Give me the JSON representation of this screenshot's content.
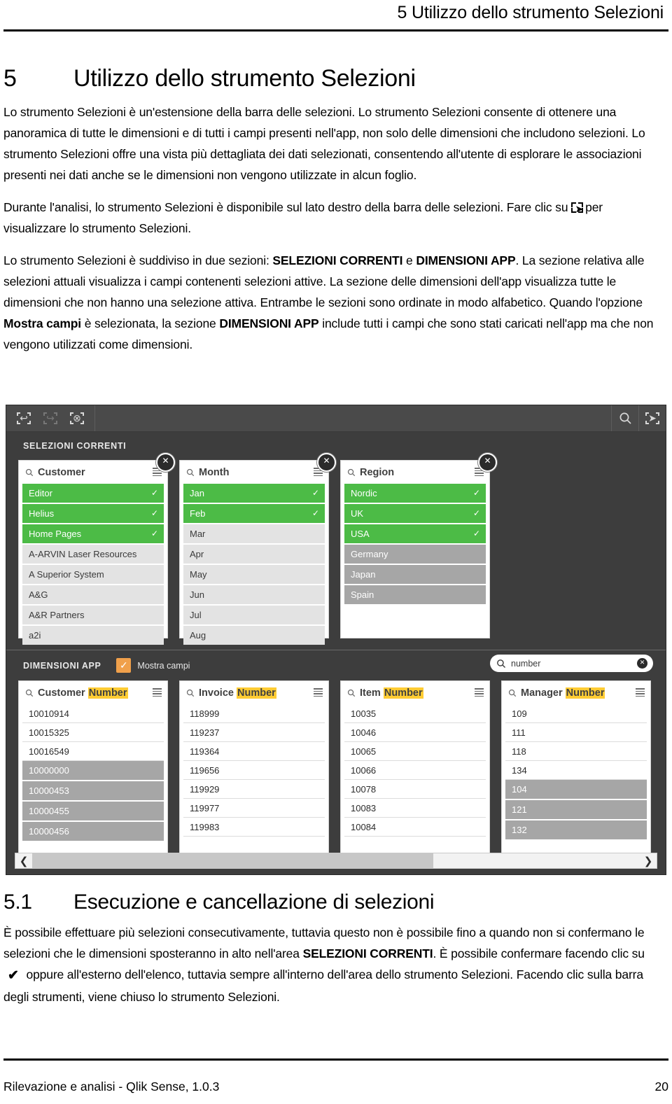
{
  "running_header": "5   Utilizzo dello strumento Selezioni",
  "chapter": {
    "number": "5",
    "title": "Utilizzo dello strumento Selezioni"
  },
  "paragraphs": {
    "p1": "Lo strumento Selezioni è un'estensione della barra delle selezioni. Lo strumento Selezioni consente di ottenere una panoramica di tutte le dimensioni e di tutti i campi presenti nell'app, non solo delle dimensioni che includono selezioni. Lo strumento Selezioni offre una vista più dettagliata dei dati selezionati, consentendo all'utente di esplorare le associazioni presenti nei dati anche se le dimensioni non vengono utilizzate in alcun foglio.",
    "p2a": "Durante l'analisi, lo strumento Selezioni è disponibile sul lato destro della barra delle selezioni. Fare clic su",
    "p2b": "per visualizzare lo strumento Selezioni.",
    "p3a": "Lo strumento Selezioni è suddiviso in due sezioni:",
    "p3_b1": "SELEZIONI CORRENTI",
    "p3b": "e",
    "p3_b2": "DIMENSIONI APP",
    "p3c": ". La sezione relativa alle selezioni attuali visualizza i campi contenenti selezioni attive. La sezione delle dimensioni dell'app visualizza tutte le dimensioni che non hanno una selezione attiva. Entrambe le sezioni sono ordinate in modo alfabetico. Quando l'opzione",
    "p3_b3": "Mostra campi",
    "p3d": "è selezionata, la sezione",
    "p3_b4": "DIMENSIONI APP",
    "p3e": "include tutti i campi che sono stati caricati nell'app ma che non vengono utilizzati come dimensioni."
  },
  "section": {
    "number": "5.1",
    "title": "Esecuzione e cancellazione di selezioni",
    "p1a": "È possibile effettuare più selezioni consecutivamente, tuttavia questo non è possibile fino a quando non si confermano le selezioni che le dimensioni sposteranno in alto nell'area",
    "p1_b1": "SELEZIONI CORRENTI",
    "p1b": ". È possibile confermare facendo clic su",
    "p1c": "oppure all'esterno dell'elenco, tuttavia sempre all'interno dell'area dello strumento Selezioni. Facendo clic sulla barra degli strumenti, viene chiuso lo strumento Selezioni.",
    "check_glyph": "✔"
  },
  "screenshot": {
    "toolbar": {
      "undo_icon": "step-back-icon",
      "redo_icon": "step-forward-icon",
      "clear_icon": "clear-selections-icon",
      "search_icon": "search-icon",
      "selections_tool_icon": "selections-tool-icon"
    },
    "current_selections": {
      "label": "SELEZIONI CORRENTI",
      "listboxes": [
        {
          "title": "Customer",
          "title_highlight": "",
          "close_glyph": "✕",
          "items": [
            {
              "value": "Editor",
              "state": "selected",
              "tick": "✓"
            },
            {
              "value": "Helius",
              "state": "selected",
              "tick": "✓"
            },
            {
              "value": "Home Pages",
              "state": "selected",
              "tick": "✓"
            },
            {
              "value": "A-ARVIN Laser Resources",
              "state": "alt",
              "tick": ""
            },
            {
              "value": "A Superior System",
              "state": "alt",
              "tick": ""
            },
            {
              "value": "A&G",
              "state": "alt",
              "tick": ""
            },
            {
              "value": "A&R Partners",
              "state": "alt",
              "tick": ""
            },
            {
              "value": "a2i",
              "state": "alt",
              "tick": ""
            }
          ]
        },
        {
          "title": "Month",
          "title_highlight": "",
          "close_glyph": "✕",
          "items": [
            {
              "value": "Jan",
              "state": "selected",
              "tick": "✓"
            },
            {
              "value": "Feb",
              "state": "selected",
              "tick": "✓"
            },
            {
              "value": "Mar",
              "state": "alt",
              "tick": ""
            },
            {
              "value": "Apr",
              "state": "alt",
              "tick": ""
            },
            {
              "value": "May",
              "state": "alt",
              "tick": ""
            },
            {
              "value": "Jun",
              "state": "alt",
              "tick": ""
            },
            {
              "value": "Jul",
              "state": "alt",
              "tick": ""
            },
            {
              "value": "Aug",
              "state": "alt",
              "tick": ""
            }
          ]
        },
        {
          "title": "Region",
          "title_highlight": "",
          "close_glyph": "✕",
          "items": [
            {
              "value": "Nordic",
              "state": "selected",
              "tick": "✓"
            },
            {
              "value": "UK",
              "state": "selected",
              "tick": "✓"
            },
            {
              "value": "USA",
              "state": "selected",
              "tick": "✓"
            },
            {
              "value": "Germany",
              "state": "excluded",
              "tick": ""
            },
            {
              "value": "Japan",
              "state": "excluded",
              "tick": ""
            },
            {
              "value": "Spain",
              "state": "excluded",
              "tick": ""
            }
          ]
        }
      ]
    },
    "app_dimensions": {
      "label": "DIMENSIONI APP",
      "show_fields_label": "Mostra campi",
      "show_fields_checked": true,
      "check_glyph": "✓",
      "search": {
        "value": "number",
        "clear_glyph": "✕"
      },
      "listboxes": [
        {
          "title": "Customer ",
          "title_highlight": "Number",
          "items": [
            {
              "value": "10010914",
              "state": "possible",
              "tick": ""
            },
            {
              "value": "10015325",
              "state": "possible",
              "tick": ""
            },
            {
              "value": "10016549",
              "state": "possible",
              "tick": ""
            },
            {
              "value": "10000000",
              "state": "excluded",
              "tick": ""
            },
            {
              "value": "10000453",
              "state": "excluded",
              "tick": ""
            },
            {
              "value": "10000455",
              "state": "excluded",
              "tick": ""
            },
            {
              "value": "10000456",
              "state": "excluded",
              "tick": ""
            }
          ]
        },
        {
          "title": "Invoice ",
          "title_highlight": "Number",
          "items": [
            {
              "value": "118999",
              "state": "possible",
              "tick": ""
            },
            {
              "value": "119237",
              "state": "possible",
              "tick": ""
            },
            {
              "value": "119364",
              "state": "possible",
              "tick": ""
            },
            {
              "value": "119656",
              "state": "possible",
              "tick": ""
            },
            {
              "value": "119929",
              "state": "possible",
              "tick": ""
            },
            {
              "value": "119977",
              "state": "possible",
              "tick": ""
            },
            {
              "value": "119983",
              "state": "possible",
              "tick": ""
            }
          ]
        },
        {
          "title": "Item ",
          "title_highlight": "Number",
          "items": [
            {
              "value": "10035",
              "state": "possible",
              "tick": ""
            },
            {
              "value": "10046",
              "state": "possible",
              "tick": ""
            },
            {
              "value": "10065",
              "state": "possible",
              "tick": ""
            },
            {
              "value": "10066",
              "state": "possible",
              "tick": ""
            },
            {
              "value": "10078",
              "state": "possible",
              "tick": ""
            },
            {
              "value": "10083",
              "state": "possible",
              "tick": ""
            },
            {
              "value": "10084",
              "state": "possible",
              "tick": ""
            }
          ]
        },
        {
          "title": "Manager ",
          "title_highlight": "Number",
          "items": [
            {
              "value": "109",
              "state": "possible",
              "tick": ""
            },
            {
              "value": "111",
              "state": "possible",
              "tick": ""
            },
            {
              "value": "118",
              "state": "possible",
              "tick": ""
            },
            {
              "value": "134",
              "state": "possible",
              "tick": ""
            },
            {
              "value": "104",
              "state": "excluded",
              "tick": ""
            },
            {
              "value": "121",
              "state": "excluded",
              "tick": ""
            },
            {
              "value": "132",
              "state": "excluded",
              "tick": ""
            }
          ]
        }
      ]
    },
    "scrollbar": {
      "left_glyph": "❮",
      "right_glyph": "❯",
      "thumb_percent": 66
    },
    "colors": {
      "selected_green": "#4cbb46",
      "excluded_gray": "#a6a6a6",
      "alternative_gray": "#e3e3e3",
      "chrome_dark": "#3d3d3d",
      "toolbar": "#4a4a4a",
      "checkbox_orange": "#f0a04b",
      "highlight_yellow": "#ffcc33"
    }
  },
  "footer": {
    "left": "Rilevazione e analisi - Qlik Sense, 1.0.3",
    "page": "20"
  }
}
